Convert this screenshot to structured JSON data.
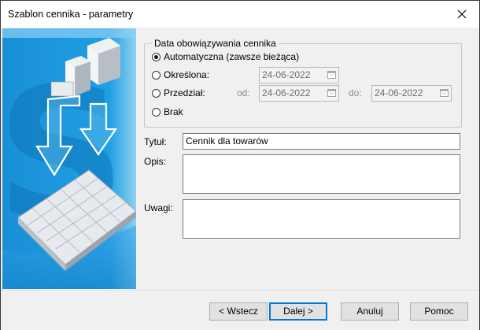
{
  "window": {
    "title": "Szablon cennika - parametry",
    "close_icon": "close-icon"
  },
  "validity": {
    "legend": "Data obowiązywania cennika",
    "selected": "automatic",
    "options": {
      "automatic": "Automatyczna (zawsze bieżąca)",
      "specific": "Określona:",
      "range": "Przedział:",
      "none": "Brak"
    },
    "specific_date": "24-06-2022",
    "range_from_label": "od:",
    "range_from": "24-06-2022",
    "range_to_label": "do:",
    "range_to": "24-06-2022",
    "calendar_icon": "calendar-icon"
  },
  "form": {
    "title_label": "Tytuł:",
    "title_value": "Cennik dla towarów",
    "description_label": "Opis:",
    "description_value": "",
    "notes_label": "Uwagi:",
    "notes_value": ""
  },
  "buttons": {
    "back": "< Wstecz",
    "next": "Dalej >",
    "cancel": "Anuluj",
    "help": "Pomoc"
  },
  "colors": {
    "banner_blue": "#1a8fd6",
    "default_button_border": "#0078d7"
  }
}
